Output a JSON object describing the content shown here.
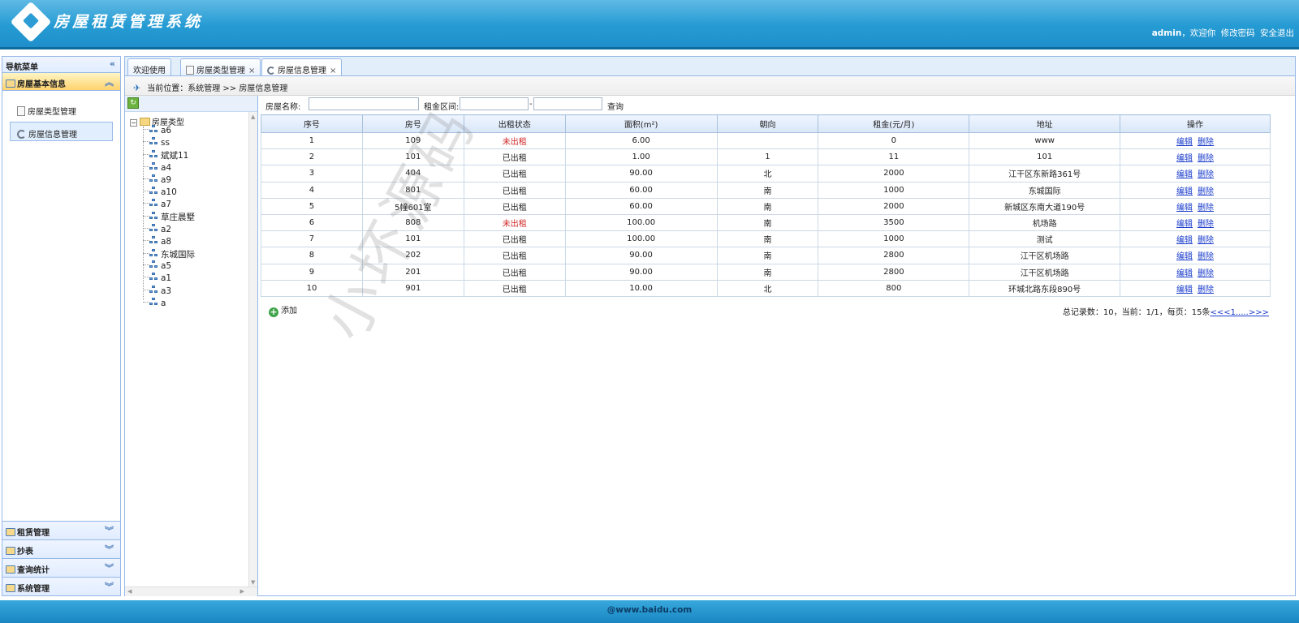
{
  "header": {
    "title": "房屋租赁管理系统",
    "user": "admin",
    "welcome": "，欢迎你",
    "change_password": "修改密码",
    "logout": "安全退出"
  },
  "nav": {
    "title": "导航菜单",
    "collapse_icon": "«",
    "panels": [
      {
        "label": "房屋基本信息",
        "items": [
          "房屋类型管理",
          "房屋信息管理"
        ]
      },
      {
        "label": "租赁管理"
      },
      {
        "label": "抄表"
      },
      {
        "label": "查询统计"
      },
      {
        "label": "系统管理"
      }
    ]
  },
  "tabs": [
    {
      "label": "欢迎使用"
    },
    {
      "label": "房屋类型管理",
      "close": "×"
    },
    {
      "label": "房屋信息管理",
      "close": "×"
    }
  ],
  "breadcrumb": "当前位置：系统管理 >> 房屋信息管理",
  "tree": {
    "root": "房屋类型",
    "nodes": [
      "a6",
      "ss",
      "斌斌11",
      "a4",
      "a9",
      "a10",
      "a7",
      "草庄晨墅",
      "a2",
      "a8",
      "东城国际",
      "a5",
      "a1",
      "a3",
      "a"
    ]
  },
  "search": {
    "name_label": "房屋名称:",
    "rent_label": "租金区间:",
    "dash": "-",
    "query": "查询"
  },
  "table": {
    "headers": [
      "序号",
      "房号",
      "出租状态",
      "面积(m²)",
      "朝向",
      "租金(元/月)",
      "地址",
      "操作"
    ],
    "edit": "编辑",
    "delete": "删除",
    "rows": [
      [
        "1",
        "109",
        "未出租",
        "6.00",
        "",
        "0",
        "www"
      ],
      [
        "2",
        "101",
        "已出租",
        "1.00",
        "1",
        "11",
        "101"
      ],
      [
        "3",
        "404",
        "已出租",
        "90.00",
        "北",
        "2000",
        "江干区东新路361号"
      ],
      [
        "4",
        "801",
        "已出租",
        "60.00",
        "南",
        "1000",
        "东城国际"
      ],
      [
        "5",
        "5幢601室",
        "已出租",
        "60.00",
        "南",
        "2000",
        "新城区东南大道190号"
      ],
      [
        "6",
        "808",
        "未出租",
        "100.00",
        "南",
        "3500",
        "机场路"
      ],
      [
        "7",
        "101",
        "已出租",
        "100.00",
        "南",
        "1000",
        "测试"
      ],
      [
        "8",
        "202",
        "已出租",
        "90.00",
        "南",
        "2800",
        "江干区机场路"
      ],
      [
        "9",
        "201",
        "已出租",
        "90.00",
        "南",
        "2800",
        "江干区机场路"
      ],
      [
        "10",
        "901",
        "已出租",
        "10.00",
        "北",
        "800",
        "环城北路东段890号"
      ]
    ]
  },
  "add_label": "添加",
  "pager": {
    "summary": "总记录数：10，当前：1/1，每页：15条",
    "links": "<<<1.....>>>"
  },
  "footer": "@www.baidu.com",
  "watermark": "小坏源码",
  "colors": {
    "header": "#259bd3",
    "border": "#95b8e7",
    "link": "#1a3ccc",
    "unrented": "#d02828"
  }
}
